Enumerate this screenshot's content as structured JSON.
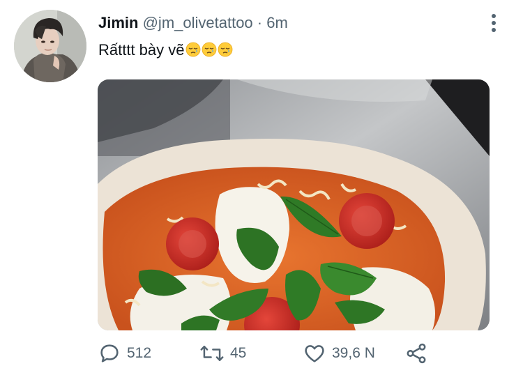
{
  "tweet": {
    "author": {
      "name": "Jimin",
      "handle": "@jm_olivetattoo"
    },
    "separator": "·",
    "time": "6m",
    "text": "Rấtttt bày vẽ",
    "emojis": [
      "sleepy-face-emoji",
      "sleepy-face-emoji",
      "sleepy-face-emoji"
    ],
    "media": {
      "subject": "uncooked margherita pizza on a metal peel"
    },
    "actions": {
      "replies": "512",
      "retweets": "45",
      "likes": "39,6 N"
    }
  },
  "colors": {
    "text": "#0f1419",
    "secondary": "#536471",
    "background": "#ffffff"
  },
  "icons": [
    "more-icon",
    "reply-icon",
    "retweet-icon",
    "like-icon",
    "share-icon"
  ]
}
